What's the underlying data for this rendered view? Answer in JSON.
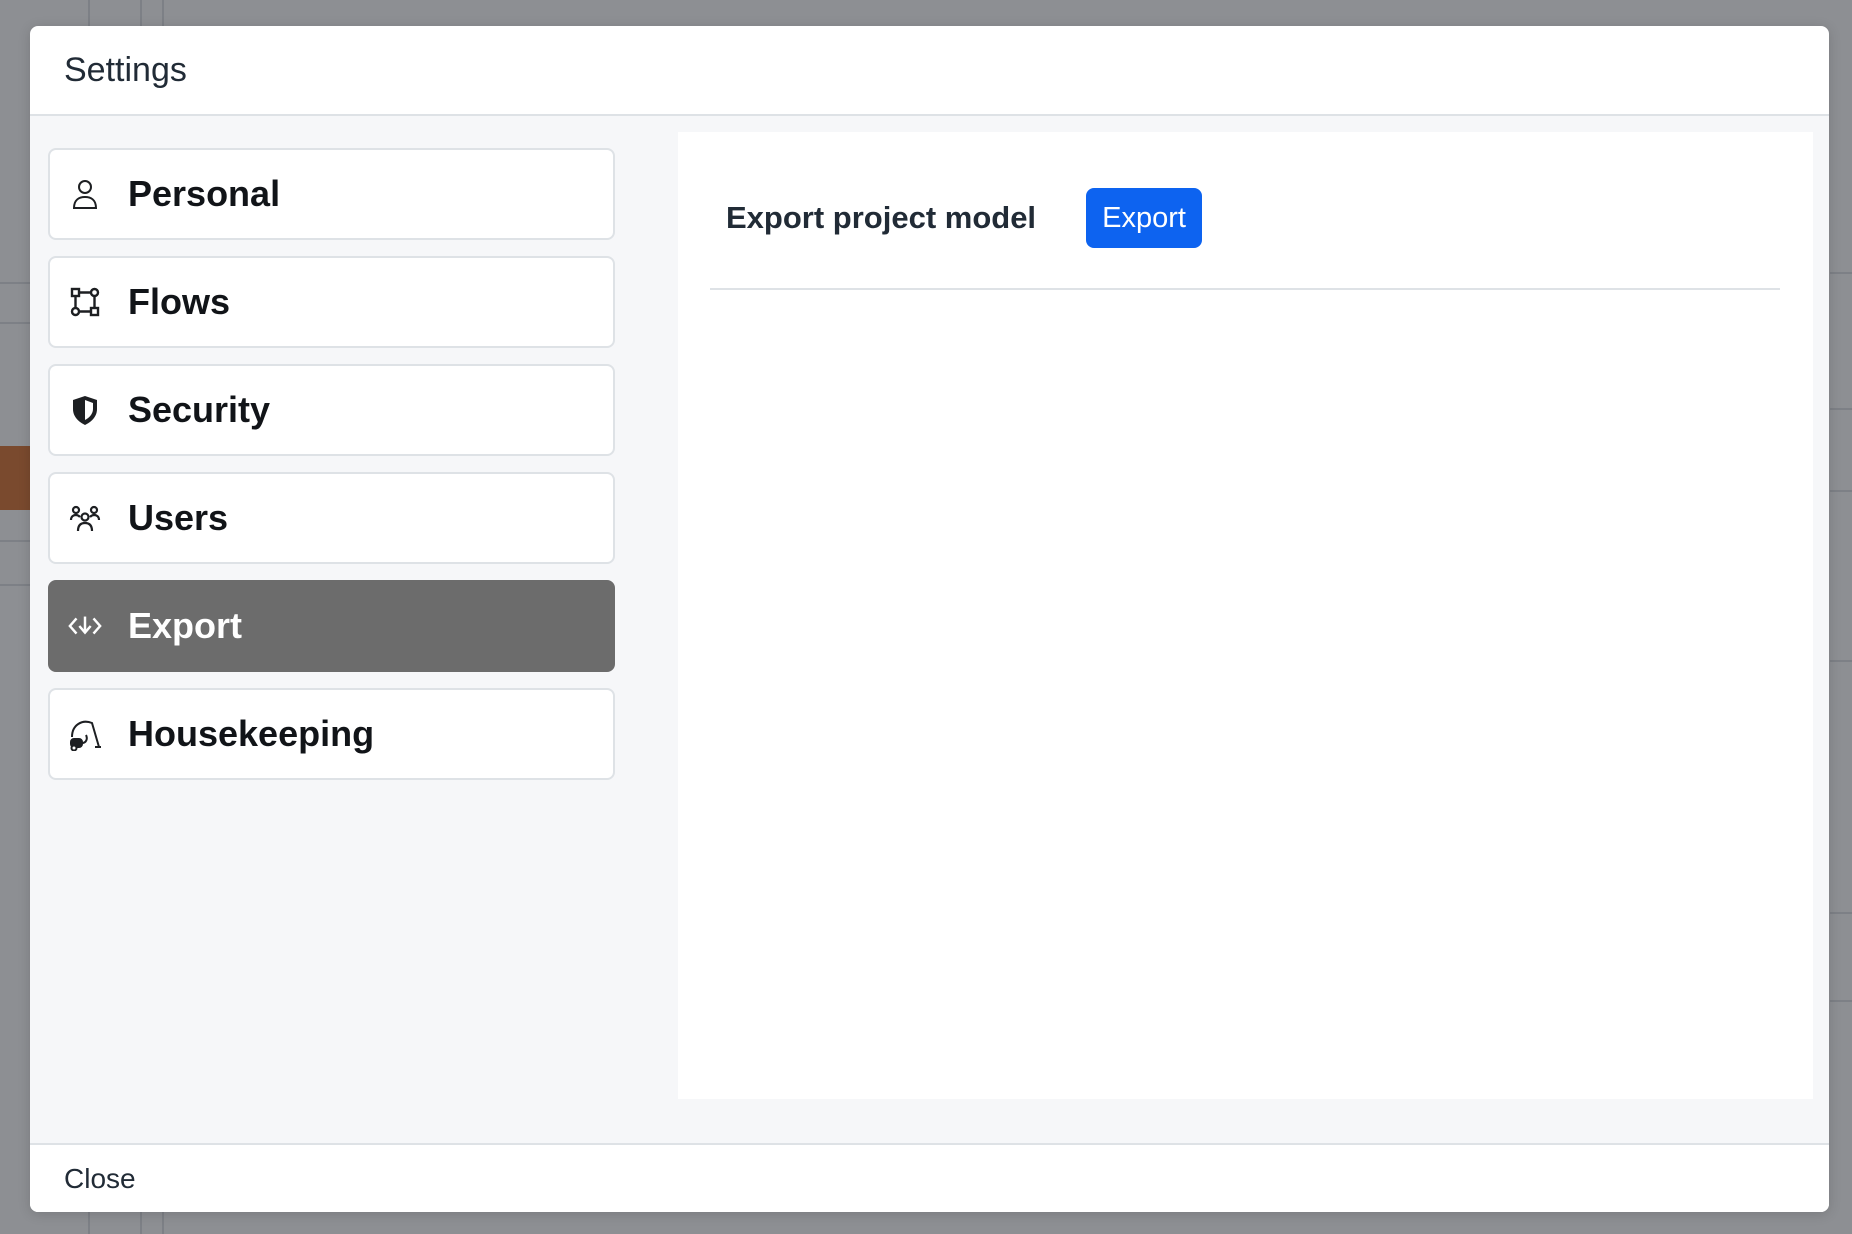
{
  "modal": {
    "title": "Settings",
    "close_label": "Close"
  },
  "sidebar": {
    "items": [
      {
        "label": "Personal",
        "icon": "person-icon",
        "active": false
      },
      {
        "label": "Flows",
        "icon": "flows-icon",
        "active": false
      },
      {
        "label": "Security",
        "icon": "shield-icon",
        "active": false
      },
      {
        "label": "Users",
        "icon": "users-icon",
        "active": false
      },
      {
        "label": "Export",
        "icon": "export-icon",
        "active": true
      },
      {
        "label": "Housekeeping",
        "icon": "vacuum-icon",
        "active": false
      }
    ]
  },
  "export_panel": {
    "label": "Export project model",
    "button_label": "Export"
  },
  "colors": {
    "accent": "#0d63f0",
    "active_nav": "#6c6c6c"
  }
}
